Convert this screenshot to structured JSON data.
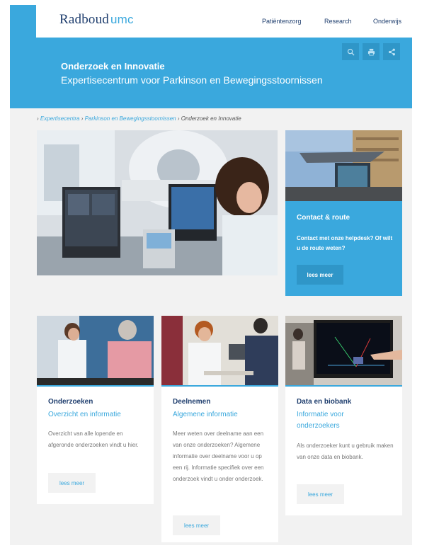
{
  "header": {
    "logo_main": "Radboud",
    "logo_accent": "umc",
    "nav": [
      "Patiëntenzorg",
      "Research",
      "Onderwijs"
    ]
  },
  "hero": {
    "title": "Onderzoek en Innovatie",
    "subtitle": "Expertisecentrum voor Parkinson en Bewegingsstoornissen",
    "tools": [
      "search-icon",
      "print-icon",
      "share-icon"
    ]
  },
  "breadcrumb": {
    "sep": "›",
    "items": [
      "Expertisecentra",
      "Parkinson en Bewegingsstoornissen",
      "Onderzoek en Innovatie"
    ]
  },
  "contact": {
    "title": "Contact & route",
    "text": "Contact met onze helpdesk? Of wilt u de route weten?",
    "button": "lees meer"
  },
  "cards": [
    {
      "title": "Onderzoeken",
      "subtitle": "Overzicht en informatie",
      "body": "Overzicht van alle lopende en afgeronde onderzoeken vindt u hier.",
      "button": "lees meer"
    },
    {
      "title": "Deelnemen",
      "subtitle": "Algemene informatie",
      "body": "Meer weten over deelname aan een van onze onderzoeken? Algemene informatie over deelname voor u op een rij. Informatie specifiek over een onderzoek vindt u onder onderzoek.",
      "button": "lees meer"
    },
    {
      "title": "Data en biobank",
      "subtitle": "Informatie voor onderzoekers",
      "body": "Als onderzoeker kunt u gebruik maken van onze data en biobank.",
      "button": "lees meer"
    }
  ],
  "colors": {
    "accent": "#3aa8dd",
    "accent_dark": "#2f96c8",
    "navy": "#1f3e6e",
    "background": "#f2f2f2"
  }
}
